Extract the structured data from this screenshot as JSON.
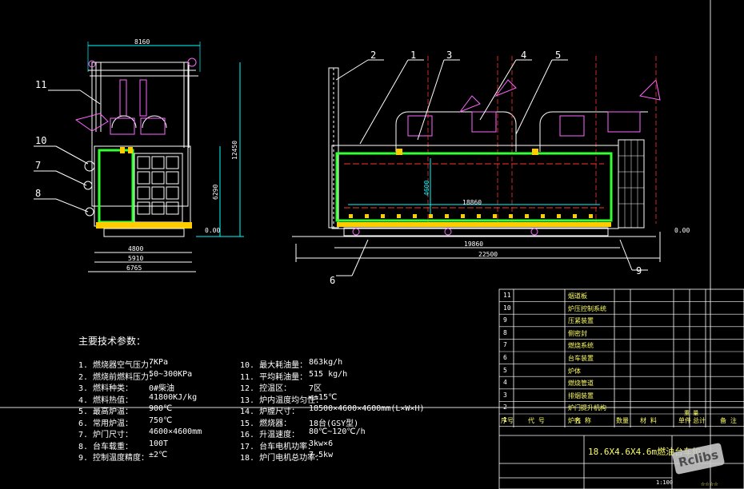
{
  "left_view": {
    "dims": [
      "8160",
      "12450",
      "6290",
      "4800",
      "5910",
      "6765",
      "0.00"
    ],
    "callouts": [
      "11",
      "10",
      "7",
      "8"
    ]
  },
  "front_view": {
    "dims": [
      "18860",
      "4600",
      "19860",
      "22500",
      "0.00"
    ],
    "callouts": [
      "2",
      "1",
      "3",
      "4",
      "5",
      "6",
      "9"
    ]
  },
  "tech_params": {
    "heading": "主要技术参数：",
    "left": [
      {
        "label": "1. 燃烧器空气压力：",
        "value": "7KPa"
      },
      {
        "label": "2. 燃烧前燃料压力：",
        "value": "50~300KPa"
      },
      {
        "label": "3. 燃料种类：",
        "value": "0#柴油"
      },
      {
        "label": "4. 燃料热值：",
        "value": "41800KJ/kg"
      },
      {
        "label": "5. 最高炉温：",
        "value": "900℃"
      },
      {
        "label": "6. 常用炉温：",
        "value": "750℃"
      },
      {
        "label": "7. 炉门尺寸：",
        "value": "4600×4600mm"
      },
      {
        "label": "8. 台车载重：",
        "value": "100T"
      },
      {
        "label": "9. 控制温度精度：",
        "value": "±2℃"
      }
    ],
    "right": [
      {
        "label": "10. 最大耗油量：",
        "value": "863kg/h"
      },
      {
        "label": "11. 平均耗油量：",
        "value": "515 kg/h"
      },
      {
        "label": "12. 控温区：",
        "value": "7区"
      },
      {
        "label": "13. 炉内温度均匀性：",
        "value": "<±15℃"
      },
      {
        "label": "14. 炉膛尺寸：",
        "value": "18500×4600×4600mm(L×W×H)"
      },
      {
        "label": "15. 燃烧器：",
        "value": "18台(GSY型)"
      },
      {
        "label": "16. 升温速度：",
        "value": "80℃~120℃/h"
      },
      {
        "label": "17. 台车电机功率：",
        "value": "3kw×6"
      },
      {
        "label": "18. 炉门电机总功率：",
        "value": "7.5kw"
      }
    ]
  },
  "parts_table": {
    "rows": [
      {
        "no": "11",
        "name": "烟道板"
      },
      {
        "no": "10",
        "name": "炉压控制系统"
      },
      {
        "no": "9",
        "name": "压紧装置"
      },
      {
        "no": "8",
        "name": "侧密封"
      },
      {
        "no": "7",
        "name": "燃烧系统"
      },
      {
        "no": "6",
        "name": "台车装置"
      },
      {
        "no": "5",
        "name": "炉体"
      },
      {
        "no": "4",
        "name": "燃烧管道"
      },
      {
        "no": "3",
        "name": "排烟装置"
      },
      {
        "no": "2",
        "name": "炉门提升机构"
      },
      {
        "no": "1",
        "name": "炉壳"
      }
    ],
    "header": [
      "序号",
      "代 号",
      "名 称",
      "数量",
      "材 料",
      "单件",
      "总计",
      "备 注",
      "重 量"
    ],
    "title": "18.6X4.6X4.6m燃油台车炉",
    "scale": "1:100",
    "sheet": "☆☆☆☆"
  },
  "watermark": "Rclibs"
}
